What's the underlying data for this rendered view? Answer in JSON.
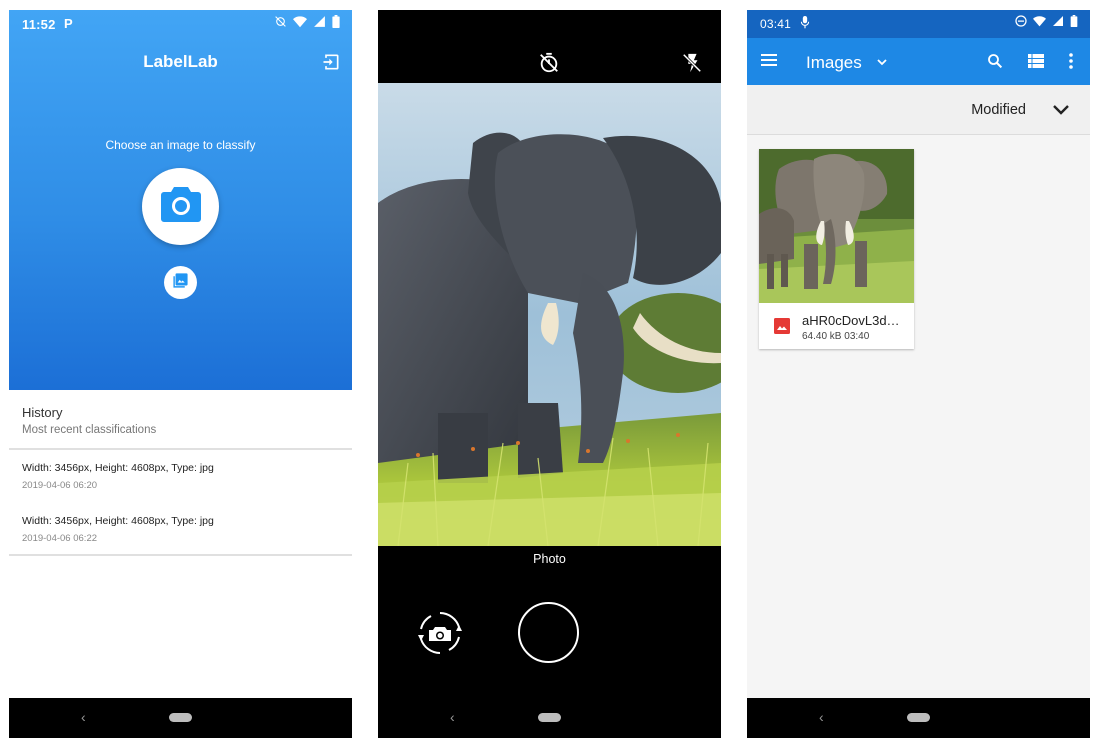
{
  "screen1": {
    "status": {
      "time": "11:52",
      "app_glyph": "P"
    },
    "app_title": "LabelLab",
    "choose_prompt": "Choose an image to classify",
    "history": {
      "title": "History",
      "subtitle": "Most recent classifications",
      "items": [
        {
          "desc": "Width: 3456px, Height: 4608px, Type: jpg",
          "date": "2019-04-06 06:20"
        },
        {
          "desc": "Width: 3456px, Height: 4608px, Type: jpg",
          "date": "2019-04-06 06:22"
        }
      ]
    },
    "icons": [
      "exit-icon",
      "camera-icon",
      "gallery-icon"
    ],
    "colors": {
      "hero_top": "#42a5f5",
      "hero_bottom": "#1c6fd6",
      "accent": "#2196f3"
    }
  },
  "screen2": {
    "mode_label": "Photo",
    "icons": [
      "timer-off-icon",
      "flash-off-icon",
      "switch-camera-icon",
      "shutter-button"
    ]
  },
  "screen3": {
    "status": {
      "time": "03:41"
    },
    "toolbar": {
      "title": "Images"
    },
    "sort": {
      "label": "Modified"
    },
    "files": [
      {
        "name": "aHR0cDovL3d…",
        "size": "64.40 kB",
        "time": "03:40"
      }
    ],
    "icons": [
      "menu-icon",
      "search-icon",
      "list-view-icon",
      "more-icon",
      "image-file-icon"
    ],
    "colors": {
      "toolbar": "#1e88e5",
      "statusbar": "#1565c0"
    }
  }
}
